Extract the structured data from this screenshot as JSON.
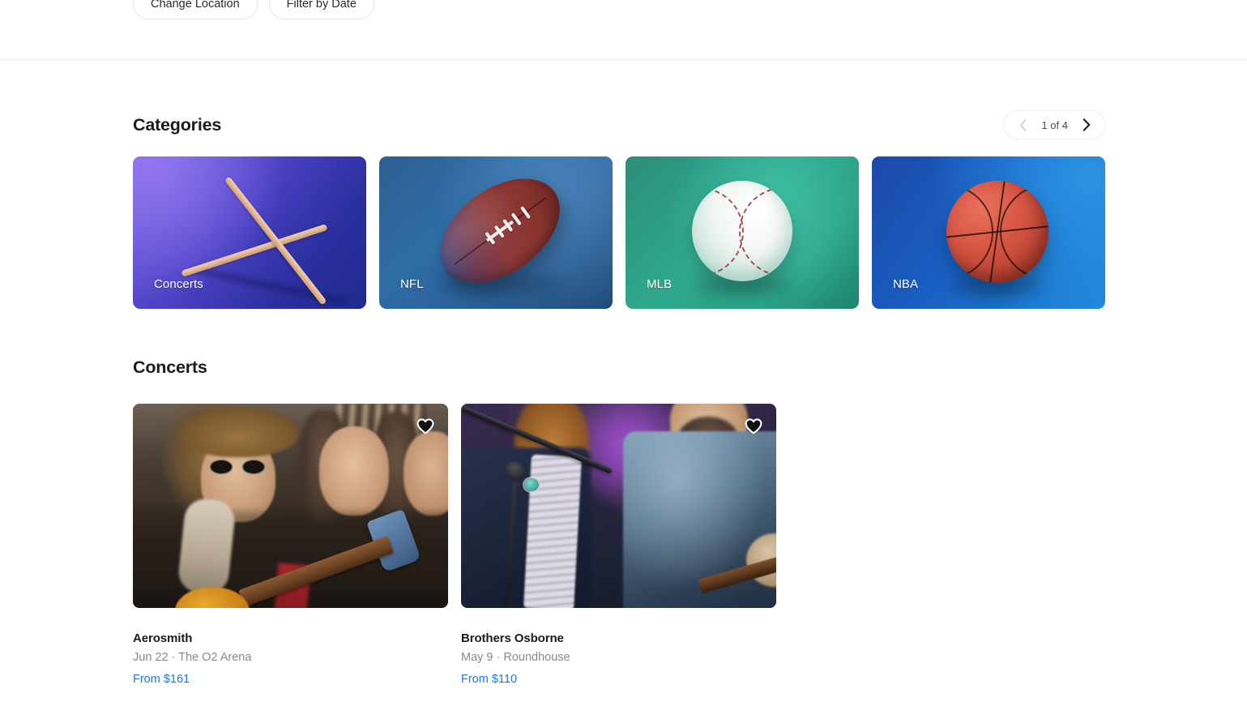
{
  "filters": {
    "change_location": "Change Location",
    "filter_by_date": "Filter by Date"
  },
  "categories_section": {
    "title": "Categories",
    "pagination": {
      "count_label": "1 of 4",
      "prev_icon": "chevron-left-icon",
      "next_icon": "chevron-right-icon"
    },
    "cards": [
      {
        "label": "Concerts",
        "art": "drumsticks",
        "accent": "#6b5ede"
      },
      {
        "label": "NFL",
        "art": "football",
        "accent": "#2f6da6"
      },
      {
        "label": "MLB",
        "art": "baseball",
        "accent": "#2fa98d"
      },
      {
        "label": "NBA",
        "art": "basketball",
        "accent": "#1a74cc"
      }
    ]
  },
  "concerts_section": {
    "title": "Concerts",
    "events": [
      {
        "title": "Aerosmith",
        "meta": "Jun 22 · The O2 Arena",
        "price": "From $161",
        "favorite_icon": "heart-icon",
        "image_alt": "Aerosmith band members performing"
      },
      {
        "title": "Brothers Osborne",
        "meta": "May 9 · Roundhouse",
        "price": "From $110",
        "favorite_icon": "heart-icon",
        "image_alt": "Brothers Osborne performing on stage"
      }
    ]
  },
  "colors": {
    "price_link": "#1878f0",
    "meta_text": "#8a8a8a",
    "heading": "#1b1b1b",
    "divider": "#ececec"
  }
}
